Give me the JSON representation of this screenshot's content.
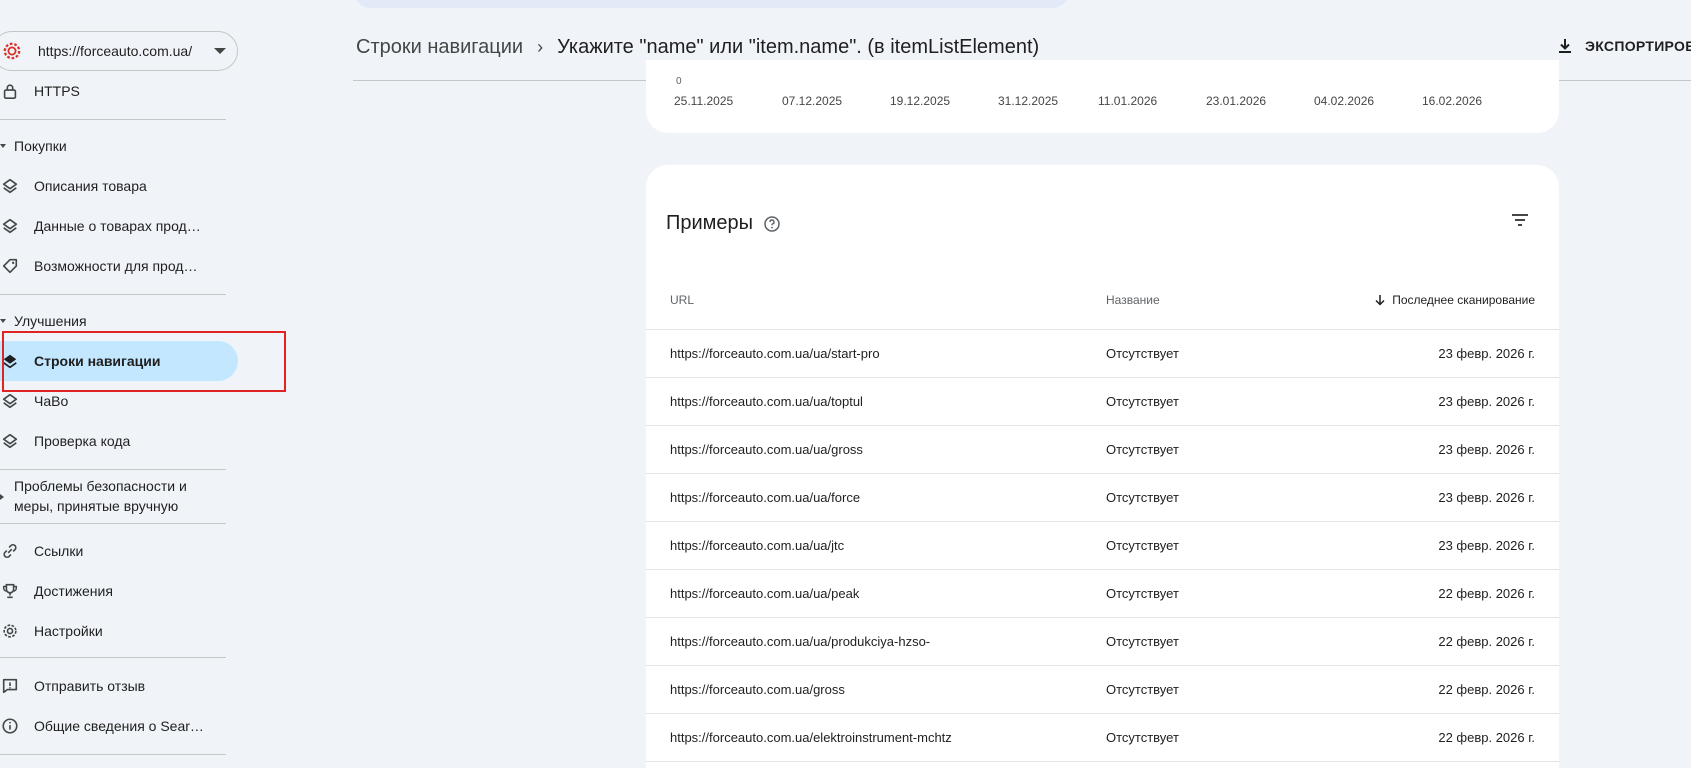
{
  "property": {
    "url": "https://forceauto.com.ua/"
  },
  "sidebar": {
    "https": "HTTPS",
    "shopping_header": "Покупки",
    "shopping_items": [
      {
        "label": "Описания товара",
        "icon": "layers-icon"
      },
      {
        "label": "Данные о товарах прод…",
        "icon": "layers-icon"
      },
      {
        "label": "Возможности для прод…",
        "icon": "tag-icon"
      }
    ],
    "enhancements_header": "Улучшения",
    "enhancement_items": [
      {
        "label": "Строки навигации",
        "icon": "layers-filled-icon",
        "active": true
      },
      {
        "label": "ЧаВо",
        "icon": "layers-icon"
      },
      {
        "label": "Проверка кода",
        "icon": "layers-icon"
      }
    ],
    "security_line1": "Проблемы безопасности и",
    "security_line2": "меры, принятые вручную",
    "other_items": [
      {
        "label": "Ссылки",
        "icon": "link-icon"
      },
      {
        "label": "Достижения",
        "icon": "trophy-icon"
      },
      {
        "label": "Настройки",
        "icon": "gear-icon"
      }
    ],
    "feedback": "Отправить отзыв",
    "about": "Общие сведения о Sear…"
  },
  "header": {
    "crumb_parent": "Строки навигации",
    "crumb_current": "Укажите \"name\" или \"item.name\". (в itemListElement)",
    "export_label": "ЭКСПОРТИРОВ"
  },
  "chart": {
    "zero_label": "0",
    "ticks": [
      "25.11.2025",
      "07.12.2025",
      "19.12.2025",
      "31.12.2025",
      "11.01.2026",
      "23.01.2026",
      "04.02.2026",
      "16.02.2026"
    ]
  },
  "examples": {
    "title": "Примеры",
    "columns": {
      "url": "URL",
      "name": "Название",
      "last_crawl": "Последнее сканирование"
    },
    "sort": "descending",
    "rows": [
      {
        "url": "https://forceauto.com.ua/ua/start-pro",
        "name": "Отсутствует",
        "date": "23 февр. 2026 г."
      },
      {
        "url": "https://forceauto.com.ua/ua/toptul",
        "name": "Отсутствует",
        "date": "23 февр. 2026 г."
      },
      {
        "url": "https://forceauto.com.ua/ua/gross",
        "name": "Отсутствует",
        "date": "23 февр. 2026 г."
      },
      {
        "url": "https://forceauto.com.ua/ua/force",
        "name": "Отсутствует",
        "date": "23 февр. 2026 г."
      },
      {
        "url": "https://forceauto.com.ua/ua/jtc",
        "name": "Отсутствует",
        "date": "23 февр. 2026 г."
      },
      {
        "url": "https://forceauto.com.ua/ua/peak",
        "name": "Отсутствует",
        "date": "22 февр. 2026 г."
      },
      {
        "url": "https://forceauto.com.ua/ua/produkciya-hzso-",
        "name": "Отсутствует",
        "date": "22 февр. 2026 г."
      },
      {
        "url": "https://forceauto.com.ua/gross",
        "name": "Отсутствует",
        "date": "22 февр. 2026 г."
      },
      {
        "url": "https://forceauto.com.ua/elektroinstrument-mchtz",
        "name": "Отсутствует",
        "date": "22 февр. 2026 г."
      }
    ]
  },
  "colors": {
    "active_bg": "#c2e7ff",
    "highlight": "#e02424",
    "page_bg": "#f0f4f9"
  }
}
